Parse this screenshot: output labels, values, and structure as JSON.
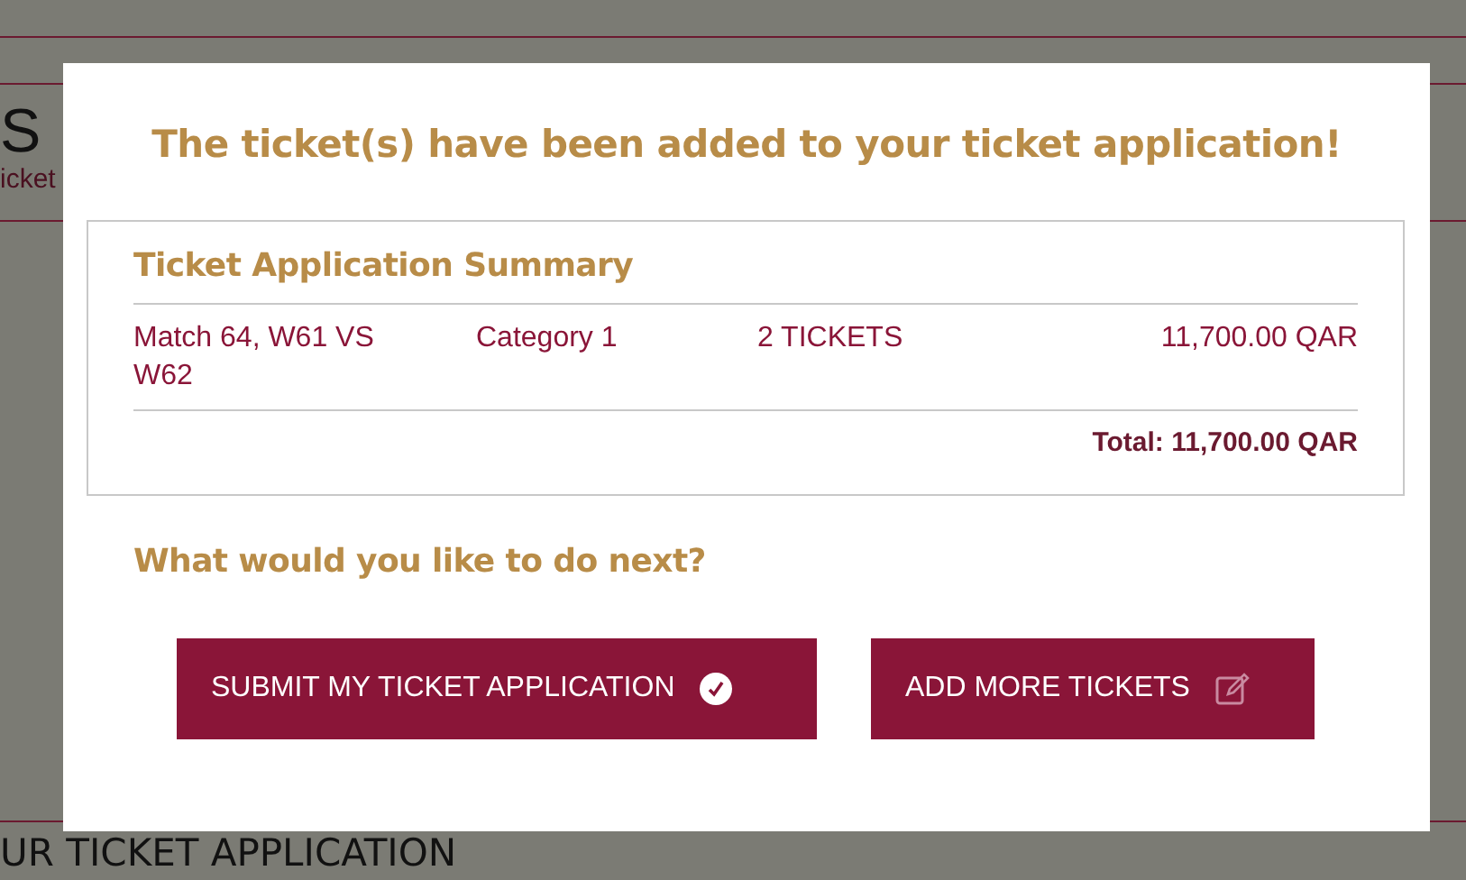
{
  "background_page": {
    "heading": "S",
    "subtitle": "icket",
    "section_heading": "UR TICKET APPLICATION"
  },
  "dialog": {
    "title": "The ticket(s) have been added to your ticket application!",
    "summary": {
      "title": "Ticket Application Summary",
      "rows": [
        {
          "match": "Match 64, W61 VS W62",
          "category": "Category 1",
          "quantity": "2 TICKETS",
          "price": "11,700.00 QAR"
        }
      ],
      "total": "Total: 11,700.00 QAR"
    },
    "next_heading": "What would you like to do next?",
    "buttons": [
      {
        "label": "SUBMIT MY TICKET APPLICATION",
        "kind": "submit"
      },
      {
        "label": "ADD MORE TICKETS",
        "kind": "add"
      }
    ]
  }
}
